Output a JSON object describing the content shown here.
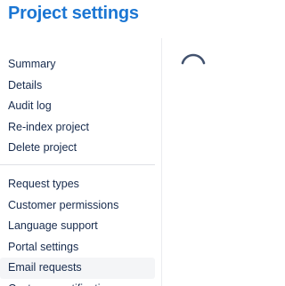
{
  "page": {
    "title": "Project settings"
  },
  "sidebar": {
    "groups": [
      {
        "items": [
          {
            "label": "Summary"
          },
          {
            "label": "Details"
          },
          {
            "label": "Audit log"
          },
          {
            "label": "Re-index project"
          },
          {
            "label": "Delete project"
          }
        ]
      },
      {
        "items": [
          {
            "label": "Request types"
          },
          {
            "label": "Customer permissions"
          },
          {
            "label": "Language support"
          },
          {
            "label": "Portal settings"
          },
          {
            "label": "Email requests",
            "selected": true
          },
          {
            "label": "Customer notifications"
          }
        ]
      }
    ]
  },
  "main": {
    "loading": true,
    "spinner_icon": "loading-spinner-icon"
  },
  "colors": {
    "title": "#1b76d3",
    "text": "#172b4d",
    "selected_bg": "#f4f5f7",
    "divider": "#dfe1e6",
    "spinner": "#42526e"
  }
}
